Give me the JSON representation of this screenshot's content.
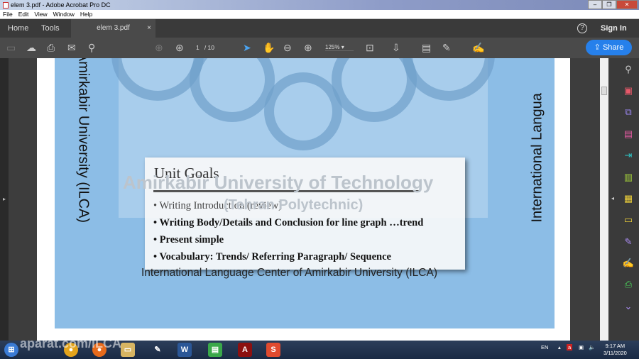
{
  "window": {
    "title": "elem 3.pdf - Adobe Acrobat Pro DC",
    "minimize": "–",
    "restore": "❐",
    "close": "✕"
  },
  "menu": [
    "File",
    "Edit",
    "View",
    "Window",
    "Help"
  ],
  "tabs": {
    "home": "Home",
    "tools": "Tools",
    "document": "elem 3.pdf",
    "close": "×",
    "help": "?",
    "sign_in": "Sign In"
  },
  "toolbar": {
    "page_current": "1",
    "page_total": "/ 10",
    "zoom": "125%",
    "share": "Share"
  },
  "slide": {
    "vertical_left": "Amirkabir University (ILCA)",
    "vertical_right": "International Langua",
    "watermark_line1": "Amirkabir University of Technology",
    "watermark_line2": "(Tehran Polytechnic)",
    "card_title": "Unit Goals",
    "bullets": [
      "• Writing Introduction (review)",
      "• Writing Body/Details and Conclusion for line graph …trend",
      "• Present simple",
      "• Vocabulary: Trends/ Referring Paragraph/ Sequence"
    ],
    "footer": "International Language Center of Amirkabir University (ILCA)"
  },
  "taskbar": {
    "watermark": "aparat.com/ILCA",
    "lang": "EN",
    "time": "9:17 AM",
    "date": "3/11/2020"
  }
}
